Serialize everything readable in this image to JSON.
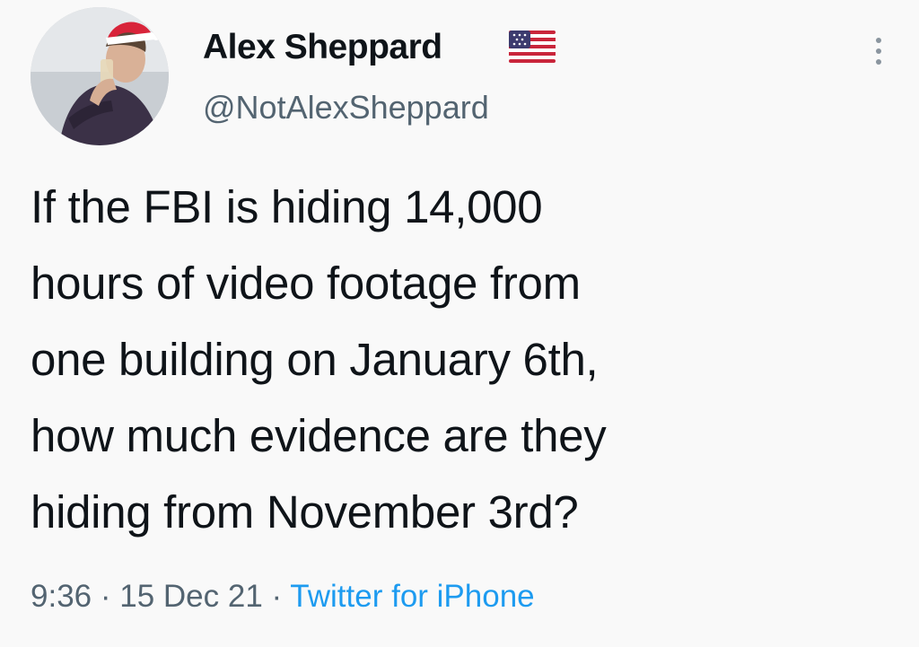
{
  "author": {
    "display_name": "Alex Sheppard",
    "handle": "@NotAlexSheppard",
    "flag_icon": "us-flag-icon",
    "avatar_description": "profile photo"
  },
  "tweet": {
    "text_lines": [
      "If the FBI is hiding 14,000",
      "hours of video footage from",
      "one building on January 6th,",
      "how much evidence are they",
      "hiding from November 3rd?"
    ]
  },
  "meta": {
    "time": "9:36",
    "separator": "·",
    "date": "15 Dec 21",
    "source": "Twitter for iPhone"
  },
  "colors": {
    "text": "#0f1419",
    "secondary_text": "#536471",
    "link": "#1d9bf0",
    "background": "#f9f9f9"
  },
  "icons": {
    "more": "more-vertical-icon"
  }
}
